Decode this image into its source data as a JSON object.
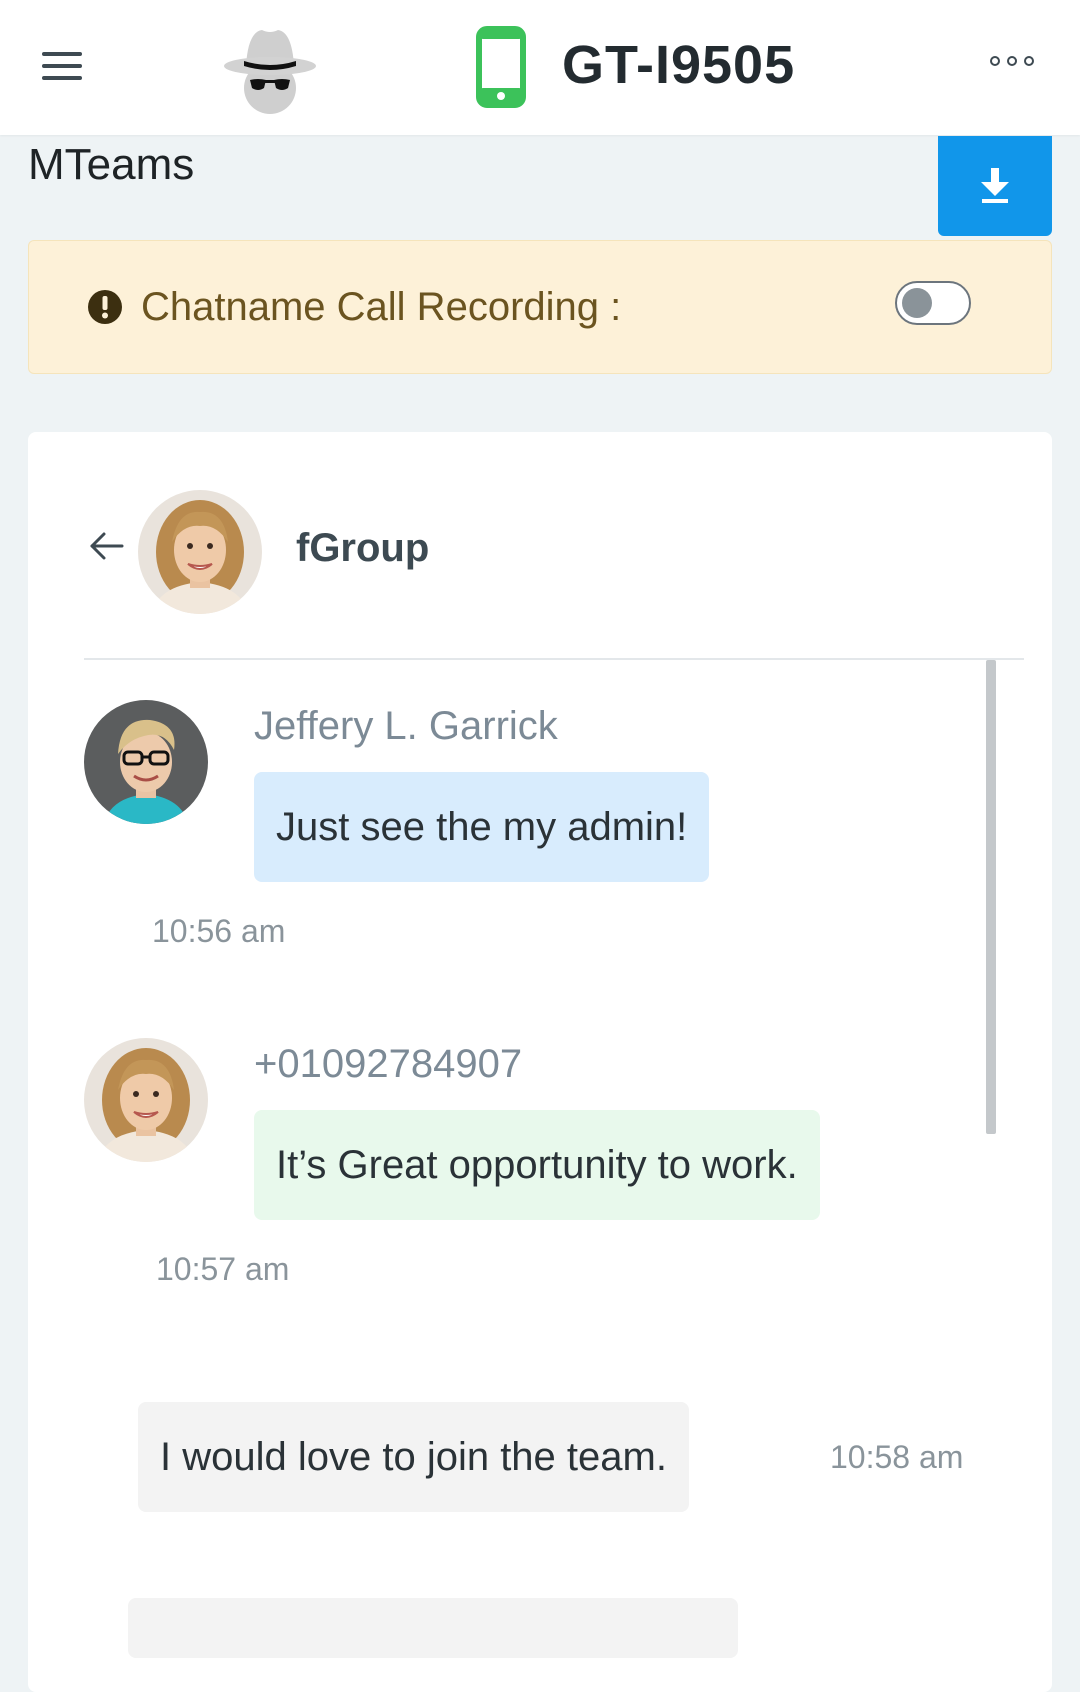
{
  "header": {
    "device_name": "GT-I9505",
    "logo_icon": "incognito-spy-icon",
    "device_icon": "smartphone-icon",
    "device_icon_color": "#3cc25a",
    "menu_icon": "hamburger-menu-icon",
    "more_icon": "more-dots-icon"
  },
  "page": {
    "title": "MTeams",
    "download_icon": "download-icon",
    "accent": "#1196ea"
  },
  "alert": {
    "label": "Chatname Call Recording :",
    "icon": "exclamation-circle-icon",
    "toggle_on": false
  },
  "chat": {
    "group_name": "fGroup",
    "back_icon": "arrow-left-icon",
    "messages": [
      {
        "sender": "Jeffery L. Garrick",
        "text": "Just see the my admin!",
        "time": "10:56 am",
        "bubble_color": "#d8ecfd"
      },
      {
        "sender": "+01092784907",
        "text": "It’s Great opportunity to work.",
        "time": "10:57 am",
        "bubble_color": "#e8f9ec"
      },
      {
        "sender": "",
        "text": "I would love to join the team.",
        "time": "10:58 am",
        "bubble_color": "#f3f3f3"
      }
    ]
  }
}
